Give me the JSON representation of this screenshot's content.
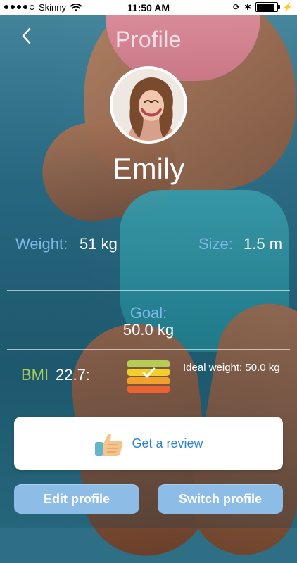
{
  "status_bar": {
    "carrier": "Skinny",
    "time": "11:50 AM",
    "signal_dots": 5,
    "battery_percent": 80
  },
  "header": {
    "title": "Profile",
    "back_icon": "chevron-left-icon"
  },
  "profile": {
    "name": "Emily",
    "avatar_icon": "user-avatar"
  },
  "stats": {
    "weight_label": "Weight:",
    "weight_value": "51 kg",
    "size_label": "Size:",
    "size_value": "1.5 m",
    "goal_label": "Goal:",
    "goal_value": "50.0 kg",
    "bmi_label": "BMI",
    "bmi_value": "22.7:",
    "ideal_weight_text": "Ideal weight: 50.0 kg"
  },
  "review": {
    "label": "Get a review",
    "icon": "thumbs-up-icon"
  },
  "buttons": {
    "edit_profile": "Edit profile",
    "switch_profile": "Switch profile"
  },
  "colors": {
    "label_blue": "#7fb7e9",
    "bmi_green": "#a9c95a",
    "button_blue": "#8dbde6",
    "review_text_blue": "#2f84c8"
  }
}
